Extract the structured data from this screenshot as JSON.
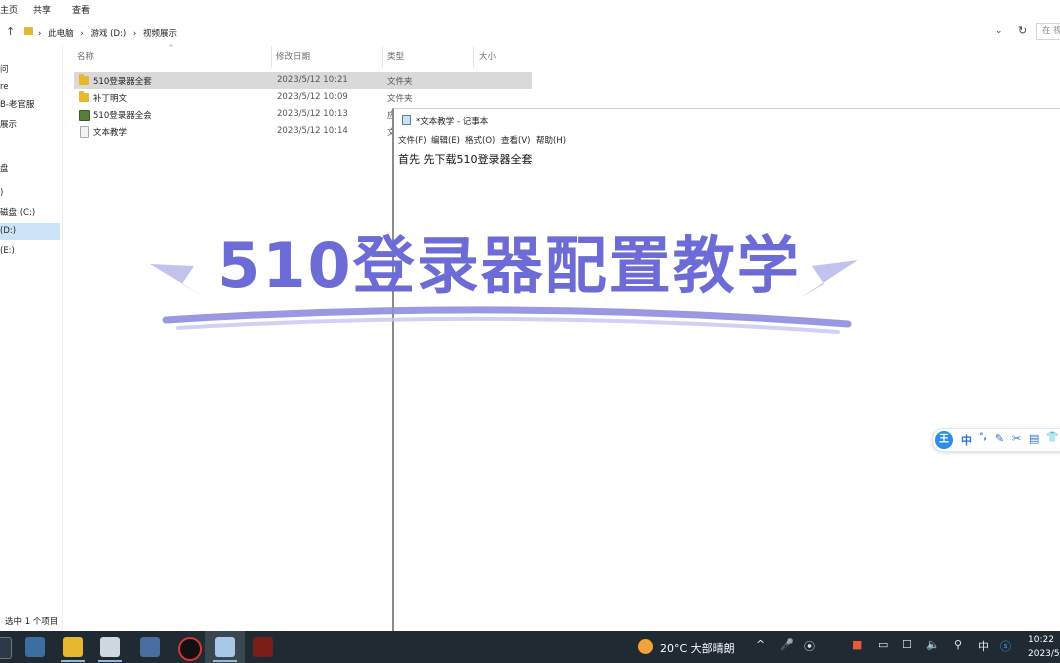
{
  "ribbon": {
    "tabs": [
      "主页",
      "共享",
      "查看"
    ]
  },
  "address": {
    "path": [
      "此电脑",
      "游戏 (D:)",
      "视频展示"
    ],
    "separator": "›",
    "up_glyph": "↑",
    "refresh_glyph": "↻",
    "dropdown_glyph": "⌄",
    "search_placeholder": "在 视"
  },
  "nav": {
    "items": [
      {
        "label": "问"
      },
      {
        "label": "re"
      },
      {
        "label": "B-老官服"
      },
      {
        "label": "展示"
      },
      {
        "label": "盘"
      },
      {
        "label": ")"
      },
      {
        "label": "磁盘 (C:)"
      },
      {
        "label": "(D:)"
      },
      {
        "label": "(E:)"
      }
    ]
  },
  "columns": {
    "name": "名称",
    "date": "修改日期",
    "type": "类型",
    "size": "大小"
  },
  "files": [
    {
      "name": "510登录器全套",
      "date": "2023/5/12 10:21",
      "type": "文件夹",
      "icon": "folder-icon"
    },
    {
      "name": "补丁明文",
      "date": "2023/5/12 10:09",
      "type": "文件夹",
      "icon": "folder-icon"
    },
    {
      "name": "510登录器全会",
      "date": "2023/5/12 10:13",
      "type": "应",
      "icon": "exe-icon"
    },
    {
      "name": "文本教学",
      "date": "2023/5/12 10:14",
      "type": "文",
      "icon": "text-file-icon"
    }
  ],
  "status": {
    "selection": "选中 1 个项目"
  },
  "notepad": {
    "title": "*文本教学 - 记事本",
    "menu": [
      "文件(F)",
      "编辑(E)",
      "格式(O)",
      "查看(V)",
      "帮助(H)"
    ],
    "content": "首先 先下载510登录器全套"
  },
  "banner": {
    "text": "510登录器配置教学",
    "color": "#6d6bd6"
  },
  "ime": {
    "logo": "王",
    "items": [
      "中",
      "°,",
      "✎",
      "✂",
      "▤",
      "👕"
    ]
  },
  "taskbar": {
    "weather": "20°C  大部晴朗",
    "tray": [
      "^",
      "🎤",
      "⦿",
      "■",
      "▭",
      "☐",
      "🔈",
      "⚲",
      "中",
      "ⓢ"
    ],
    "time": "10:22",
    "date": "2023/5/"
  }
}
